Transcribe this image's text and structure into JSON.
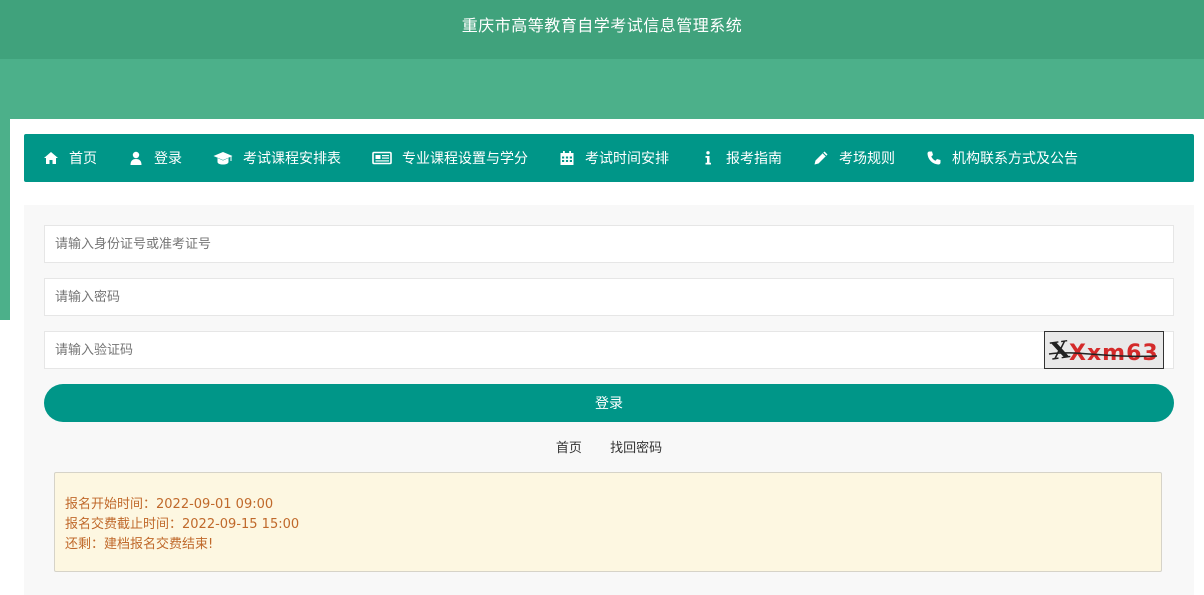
{
  "header": {
    "title": "重庆市高等教育自学考试信息管理系统"
  },
  "nav": {
    "items": [
      {
        "label": "首页",
        "icon": "home-icon"
      },
      {
        "label": "登录",
        "icon": "user-icon"
      },
      {
        "label": "考试课程安排表",
        "icon": "graduation-cap-icon"
      },
      {
        "label": "专业课程设置与学分",
        "icon": "newspaper-icon"
      },
      {
        "label": "考试时间安排",
        "icon": "calendar-icon"
      },
      {
        "label": "报考指南",
        "icon": "info-icon"
      },
      {
        "label": "考场规则",
        "icon": "pencil-icon"
      },
      {
        "label": "机构联系方式及公告",
        "icon": "phone-icon"
      }
    ]
  },
  "form": {
    "id_placeholder": "请输入身份证号或准考证号",
    "id_value": "",
    "password_placeholder": "请输入密码",
    "password_value": "",
    "captcha_placeholder": "请输入验证码",
    "captcha_value": "",
    "captcha_image_text": "Xxm63",
    "login_label": "登录"
  },
  "links": {
    "home": "首页",
    "recover": "找回密码"
  },
  "notice": {
    "line1": "报名开始时间：2022-09-01 09:00",
    "line2": "报名交费截止时间：2022-09-15 15:00",
    "line3": "还剩：建档报名交费结束!"
  },
  "colors": {
    "header_bg": "#40a27c",
    "band_bg": "#4cb08a",
    "primary": "#009688",
    "notice_bg": "#fdf7e1",
    "notice_text": "#c0692b"
  }
}
